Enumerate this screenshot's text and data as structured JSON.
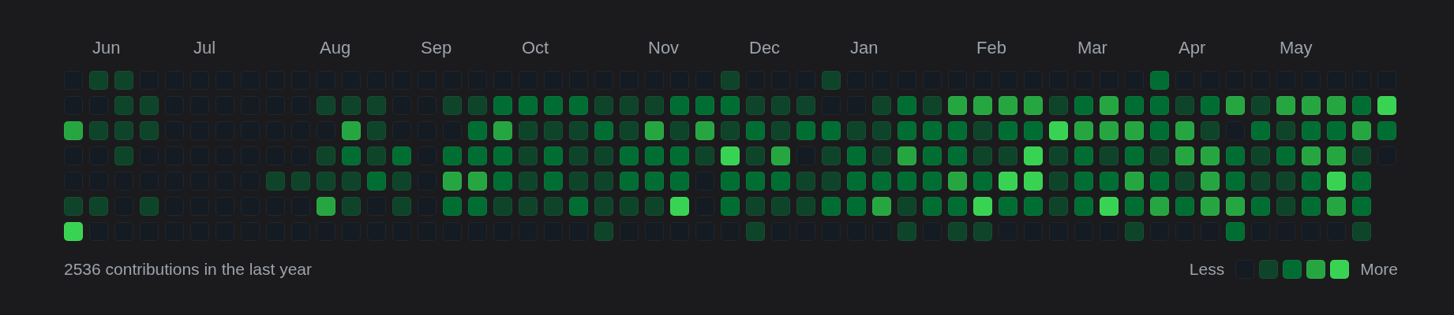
{
  "weeks": [
    {
      "days": [
        {
          "color": "#151b23"
        },
        {
          "color": "#151b23"
        },
        {
          "color": "#26a641"
        },
        {
          "color": "#151b23"
        },
        {
          "color": "#151b23"
        },
        {
          "color": "#0e4429"
        },
        {
          "color": "#39d353"
        }
      ]
    },
    {
      "month": "Jun",
      "days": [
        {
          "color": "#0e4429"
        },
        {
          "color": "#151b23"
        },
        {
          "color": "#0e4429"
        },
        {
          "color": "#151b23"
        },
        {
          "color": "#151b23"
        },
        {
          "color": "#0e4429"
        },
        {
          "color": "#151b23"
        }
      ]
    },
    {
      "days": [
        {
          "color": "#0e4429"
        },
        {
          "color": "#0e4429"
        },
        {
          "color": "#0e4429"
        },
        {
          "color": "#0e4429"
        },
        {
          "color": "#151b23"
        },
        {
          "color": "#151b23"
        },
        {
          "color": "#151b23"
        }
      ]
    },
    {
      "days": [
        {
          "color": "#151b23"
        },
        {
          "color": "#0e4429"
        },
        {
          "color": "#0e4429"
        },
        {
          "color": "#151b23"
        },
        {
          "color": "#151b23"
        },
        {
          "color": "#0e4429"
        },
        {
          "color": "#151b23"
        }
      ]
    },
    {
      "days": [
        {
          "color": "#151b23"
        },
        {
          "color": "#151b23"
        },
        {
          "color": "#151b23"
        },
        {
          "color": "#151b23"
        },
        {
          "color": "#151b23"
        },
        {
          "color": "#151b23"
        },
        {
          "color": "#151b23"
        }
      ]
    },
    {
      "month": "Jul",
      "days": [
        {
          "color": "#151b23"
        },
        {
          "color": "#151b23"
        },
        {
          "color": "#151b23"
        },
        {
          "color": "#151b23"
        },
        {
          "color": "#151b23"
        },
        {
          "color": "#151b23"
        },
        {
          "color": "#151b23"
        }
      ]
    },
    {
      "days": [
        {
          "color": "#151b23"
        },
        {
          "color": "#151b23"
        },
        {
          "color": "#151b23"
        },
        {
          "color": "#151b23"
        },
        {
          "color": "#151b23"
        },
        {
          "color": "#151b23"
        },
        {
          "color": "#151b23"
        }
      ]
    },
    {
      "days": [
        {
          "color": "#151b23"
        },
        {
          "color": "#151b23"
        },
        {
          "color": "#151b23"
        },
        {
          "color": "#151b23"
        },
        {
          "color": "#151b23"
        },
        {
          "color": "#151b23"
        },
        {
          "color": "#151b23"
        }
      ]
    },
    {
      "days": [
        {
          "color": "#151b23"
        },
        {
          "color": "#151b23"
        },
        {
          "color": "#151b23"
        },
        {
          "color": "#151b23"
        },
        {
          "color": "#0e4429"
        },
        {
          "color": "#151b23"
        },
        {
          "color": "#151b23"
        }
      ]
    },
    {
      "days": [
        {
          "color": "#151b23"
        },
        {
          "color": "#151b23"
        },
        {
          "color": "#151b23"
        },
        {
          "color": "#151b23"
        },
        {
          "color": "#0e4429"
        },
        {
          "color": "#151b23"
        },
        {
          "color": "#151b23"
        }
      ]
    },
    {
      "month": "Aug",
      "days": [
        {
          "color": "#151b23"
        },
        {
          "color": "#0e4429"
        },
        {
          "color": "#151b23"
        },
        {
          "color": "#0e4429"
        },
        {
          "color": "#0e4429"
        },
        {
          "color": "#26a641"
        },
        {
          "color": "#151b23"
        }
      ]
    },
    {
      "days": [
        {
          "color": "#151b23"
        },
        {
          "color": "#0e4429"
        },
        {
          "color": "#26a641"
        },
        {
          "color": "#006d32"
        },
        {
          "color": "#0e4429"
        },
        {
          "color": "#0e4429"
        },
        {
          "color": "#151b23"
        }
      ]
    },
    {
      "days": [
        {
          "color": "#151b23"
        },
        {
          "color": "#0e4429"
        },
        {
          "color": "#0e4429"
        },
        {
          "color": "#0e4429"
        },
        {
          "color": "#006d32"
        },
        {
          "color": "#151b23"
        },
        {
          "color": "#151b23"
        }
      ]
    },
    {
      "days": [
        {
          "color": "#151b23"
        },
        {
          "color": "#151b23"
        },
        {
          "color": "#151b23"
        },
        {
          "color": "#006d32"
        },
        {
          "color": "#0e4429"
        },
        {
          "color": "#0e4429"
        },
        {
          "color": "#151b23"
        }
      ]
    },
    {
      "month": "Sep",
      "days": [
        {
          "color": "#151b23"
        },
        {
          "color": "#151b23"
        },
        {
          "color": "#151b23"
        },
        {
          "color": "#151b23"
        },
        {
          "color": "#151b23"
        },
        {
          "color": "#151b23"
        },
        {
          "color": "#151b23"
        }
      ]
    },
    {
      "days": [
        {
          "color": "#151b23"
        },
        {
          "color": "#0e4429"
        },
        {
          "color": "#151b23"
        },
        {
          "color": "#006d32"
        },
        {
          "color": "#26a641"
        },
        {
          "color": "#006d32"
        },
        {
          "color": "#151b23"
        }
      ]
    },
    {
      "days": [
        {
          "color": "#151b23"
        },
        {
          "color": "#0e4429"
        },
        {
          "color": "#006d32"
        },
        {
          "color": "#006d32"
        },
        {
          "color": "#26a641"
        },
        {
          "color": "#006d32"
        },
        {
          "color": "#151b23"
        }
      ]
    },
    {
      "days": [
        {
          "color": "#151b23"
        },
        {
          "color": "#006d32"
        },
        {
          "color": "#26a641"
        },
        {
          "color": "#006d32"
        },
        {
          "color": "#006d32"
        },
        {
          "color": "#0e4429"
        },
        {
          "color": "#151b23"
        }
      ]
    },
    {
      "month": "Oct",
      "days": [
        {
          "color": "#151b23"
        },
        {
          "color": "#006d32"
        },
        {
          "color": "#0e4429"
        },
        {
          "color": "#0e4429"
        },
        {
          "color": "#0e4429"
        },
        {
          "color": "#0e4429"
        },
        {
          "color": "#151b23"
        }
      ]
    },
    {
      "days": [
        {
          "color": "#151b23"
        },
        {
          "color": "#006d32"
        },
        {
          "color": "#0e4429"
        },
        {
          "color": "#006d32"
        },
        {
          "color": "#006d32"
        },
        {
          "color": "#0e4429"
        },
        {
          "color": "#151b23"
        }
      ]
    },
    {
      "days": [
        {
          "color": "#151b23"
        },
        {
          "color": "#006d32"
        },
        {
          "color": "#0e4429"
        },
        {
          "color": "#0e4429"
        },
        {
          "color": "#0e4429"
        },
        {
          "color": "#006d32"
        },
        {
          "color": "#151b23"
        }
      ]
    },
    {
      "days": [
        {
          "color": "#151b23"
        },
        {
          "color": "#0e4429"
        },
        {
          "color": "#006d32"
        },
        {
          "color": "#0e4429"
        },
        {
          "color": "#0e4429"
        },
        {
          "color": "#0e4429"
        },
        {
          "color": "#0e4429"
        }
      ]
    },
    {
      "days": [
        {
          "color": "#151b23"
        },
        {
          "color": "#0e4429"
        },
        {
          "color": "#0e4429"
        },
        {
          "color": "#006d32"
        },
        {
          "color": "#006d32"
        },
        {
          "color": "#0e4429"
        },
        {
          "color": "#151b23"
        }
      ]
    },
    {
      "month": "Nov",
      "days": [
        {
          "color": "#151b23"
        },
        {
          "color": "#0e4429"
        },
        {
          "color": "#26a641"
        },
        {
          "color": "#006d32"
        },
        {
          "color": "#006d32"
        },
        {
          "color": "#0e4429"
        },
        {
          "color": "#151b23"
        }
      ]
    },
    {
      "days": [
        {
          "color": "#151b23"
        },
        {
          "color": "#006d32"
        },
        {
          "color": "#0e4429"
        },
        {
          "color": "#006d32"
        },
        {
          "color": "#006d32"
        },
        {
          "color": "#39d353"
        },
        {
          "color": "#151b23"
        }
      ]
    },
    {
      "days": [
        {
          "color": "#151b23"
        },
        {
          "color": "#006d32"
        },
        {
          "color": "#26a641"
        },
        {
          "color": "#0e4429"
        },
        {
          "color": "#151b23"
        },
        {
          "color": "#151b23"
        },
        {
          "color": "#151b23"
        }
      ]
    },
    {
      "days": [
        {
          "color": "#0e4429"
        },
        {
          "color": "#006d32"
        },
        {
          "color": "#0e4429"
        },
        {
          "color": "#39d353"
        },
        {
          "color": "#006d32"
        },
        {
          "color": "#006d32"
        },
        {
          "color": "#151b23"
        }
      ]
    },
    {
      "month": "Dec",
      "days": [
        {
          "color": "#151b23"
        },
        {
          "color": "#0e4429"
        },
        {
          "color": "#006d32"
        },
        {
          "color": "#0e4429"
        },
        {
          "color": "#006d32"
        },
        {
          "color": "#0e4429"
        },
        {
          "color": "#0e4429"
        }
      ]
    },
    {
      "days": [
        {
          "color": "#151b23"
        },
        {
          "color": "#0e4429"
        },
        {
          "color": "#0e4429"
        },
        {
          "color": "#26a641"
        },
        {
          "color": "#006d32"
        },
        {
          "color": "#0e4429"
        },
        {
          "color": "#151b23"
        }
      ]
    },
    {
      "days": [
        {
          "color": "#151b23"
        },
        {
          "color": "#0e4429"
        },
        {
          "color": "#006d32"
        },
        {
          "color": "#151b23"
        },
        {
          "color": "#0e4429"
        },
        {
          "color": "#0e4429"
        },
        {
          "color": "#151b23"
        }
      ]
    },
    {
      "days": [
        {
          "color": "#0e4429"
        },
        {
          "color": "#151b23"
        },
        {
          "color": "#006d32"
        },
        {
          "color": "#0e4429"
        },
        {
          "color": "#0e4429"
        },
        {
          "color": "#006d32"
        },
        {
          "color": "#151b23"
        }
      ]
    },
    {
      "month": "Jan",
      "days": [
        {
          "color": "#151b23"
        },
        {
          "color": "#151b23"
        },
        {
          "color": "#0e4429"
        },
        {
          "color": "#006d32"
        },
        {
          "color": "#006d32"
        },
        {
          "color": "#006d32"
        },
        {
          "color": "#151b23"
        }
      ]
    },
    {
      "days": [
        {
          "color": "#151b23"
        },
        {
          "color": "#0e4429"
        },
        {
          "color": "#0e4429"
        },
        {
          "color": "#0e4429"
        },
        {
          "color": "#006d32"
        },
        {
          "color": "#26a641"
        },
        {
          "color": "#151b23"
        }
      ]
    },
    {
      "days": [
        {
          "color": "#151b23"
        },
        {
          "color": "#006d32"
        },
        {
          "color": "#006d32"
        },
        {
          "color": "#26a641"
        },
        {
          "color": "#006d32"
        },
        {
          "color": "#0e4429"
        },
        {
          "color": "#0e4429"
        }
      ]
    },
    {
      "days": [
        {
          "color": "#151b23"
        },
        {
          "color": "#0e4429"
        },
        {
          "color": "#006d32"
        },
        {
          "color": "#006d32"
        },
        {
          "color": "#006d32"
        },
        {
          "color": "#006d32"
        },
        {
          "color": "#151b23"
        }
      ]
    },
    {
      "days": [
        {
          "color": "#151b23"
        },
        {
          "color": "#26a641"
        },
        {
          "color": "#006d32"
        },
        {
          "color": "#006d32"
        },
        {
          "color": "#26a641"
        },
        {
          "color": "#006d32"
        },
        {
          "color": "#0e4429"
        }
      ]
    },
    {
      "month": "Feb",
      "days": [
        {
          "color": "#151b23"
        },
        {
          "color": "#26a641"
        },
        {
          "color": "#0e4429"
        },
        {
          "color": "#0e4429"
        },
        {
          "color": "#006d32"
        },
        {
          "color": "#39d353"
        },
        {
          "color": "#0e4429"
        }
      ]
    },
    {
      "days": [
        {
          "color": "#151b23"
        },
        {
          "color": "#26a641"
        },
        {
          "color": "#006d32"
        },
        {
          "color": "#0e4429"
        },
        {
          "color": "#39d353"
        },
        {
          "color": "#006d32"
        },
        {
          "color": "#151b23"
        }
      ]
    },
    {
      "days": [
        {
          "color": "#151b23"
        },
        {
          "color": "#26a641"
        },
        {
          "color": "#006d32"
        },
        {
          "color": "#39d353"
        },
        {
          "color": "#39d353"
        },
        {
          "color": "#006d32"
        },
        {
          "color": "#151b23"
        }
      ]
    },
    {
      "days": [
        {
          "color": "#151b23"
        },
        {
          "color": "#0e4429"
        },
        {
          "color": "#39d353"
        },
        {
          "color": "#0e4429"
        },
        {
          "color": "#0e4429"
        },
        {
          "color": "#0e4429"
        },
        {
          "color": "#151b23"
        }
      ]
    },
    {
      "month": "Mar",
      "days": [
        {
          "color": "#151b23"
        },
        {
          "color": "#006d32"
        },
        {
          "color": "#26a641"
        },
        {
          "color": "#006d32"
        },
        {
          "color": "#006d32"
        },
        {
          "color": "#006d32"
        },
        {
          "color": "#151b23"
        }
      ]
    },
    {
      "days": [
        {
          "color": "#151b23"
        },
        {
          "color": "#26a641"
        },
        {
          "color": "#26a641"
        },
        {
          "color": "#0e4429"
        },
        {
          "color": "#006d32"
        },
        {
          "color": "#39d353"
        },
        {
          "color": "#151b23"
        }
      ]
    },
    {
      "days": [
        {
          "color": "#151b23"
        },
        {
          "color": "#006d32"
        },
        {
          "color": "#26a641"
        },
        {
          "color": "#006d32"
        },
        {
          "color": "#26a641"
        },
        {
          "color": "#006d32"
        },
        {
          "color": "#0e4429"
        }
      ]
    },
    {
      "days": [
        {
          "color": "#006d32"
        },
        {
          "color": "#006d32"
        },
        {
          "color": "#006d32"
        },
        {
          "color": "#0e4429"
        },
        {
          "color": "#006d32"
        },
        {
          "color": "#26a641"
        },
        {
          "color": "#151b23"
        }
      ]
    },
    {
      "month": "Apr",
      "days": [
        {
          "color": "#151b23"
        },
        {
          "color": "#0e4429"
        },
        {
          "color": "#26a641"
        },
        {
          "color": "#26a641"
        },
        {
          "color": "#0e4429"
        },
        {
          "color": "#006d32"
        },
        {
          "color": "#151b23"
        }
      ]
    },
    {
      "days": [
        {
          "color": "#151b23"
        },
        {
          "color": "#006d32"
        },
        {
          "color": "#0e4429"
        },
        {
          "color": "#26a641"
        },
        {
          "color": "#26a641"
        },
        {
          "color": "#26a641"
        },
        {
          "color": "#151b23"
        }
      ]
    },
    {
      "days": [
        {
          "color": "#151b23"
        },
        {
          "color": "#26a641"
        },
        {
          "color": "#151b23"
        },
        {
          "color": "#006d32"
        },
        {
          "color": "#006d32"
        },
        {
          "color": "#26a641"
        },
        {
          "color": "#006d32"
        }
      ]
    },
    {
      "days": [
        {
          "color": "#151b23"
        },
        {
          "color": "#0e4429"
        },
        {
          "color": "#006d32"
        },
        {
          "color": "#0e4429"
        },
        {
          "color": "#0e4429"
        },
        {
          "color": "#006d32"
        },
        {
          "color": "#151b23"
        }
      ]
    },
    {
      "month": "May",
      "days": [
        {
          "color": "#151b23"
        },
        {
          "color": "#26a641"
        },
        {
          "color": "#0e4429"
        },
        {
          "color": "#006d32"
        },
        {
          "color": "#0e4429"
        },
        {
          "color": "#0e4429"
        },
        {
          "color": "#151b23"
        }
      ]
    },
    {
      "days": [
        {
          "color": "#151b23"
        },
        {
          "color": "#26a641"
        },
        {
          "color": "#006d32"
        },
        {
          "color": "#26a641"
        },
        {
          "color": "#006d32"
        },
        {
          "color": "#006d32"
        },
        {
          "color": "#151b23"
        }
      ]
    },
    {
      "days": [
        {
          "color": "#151b23"
        },
        {
          "color": "#26a641"
        },
        {
          "color": "#006d32"
        },
        {
          "color": "#26a641"
        },
        {
          "color": "#39d353"
        },
        {
          "color": "#26a641"
        },
        {
          "color": "#151b23"
        }
      ]
    },
    {
      "days": [
        {
          "color": "#151b23"
        },
        {
          "color": "#006d32"
        },
        {
          "color": "#26a641"
        },
        {
          "color": "#0e4429"
        },
        {
          "color": "#006d32"
        },
        {
          "color": "#006d32"
        },
        {
          "color": "#0e4429"
        }
      ]
    },
    {
      "days": [
        {
          "color": "#151b23"
        },
        {
          "color": "#39d353"
        },
        {
          "color": "#006d32"
        },
        {
          "color": "#151b23"
        }
      ]
    }
  ],
  "summary": "2536 contributions in the last year",
  "legend": {
    "less": "Less",
    "more": "More",
    "swatches": [
      {
        "color": "#151b23"
      },
      {
        "color": "#0e4429"
      },
      {
        "color": "#006d32"
      },
      {
        "color": "#26a641"
      },
      {
        "color": "#39d353"
      }
    ]
  }
}
